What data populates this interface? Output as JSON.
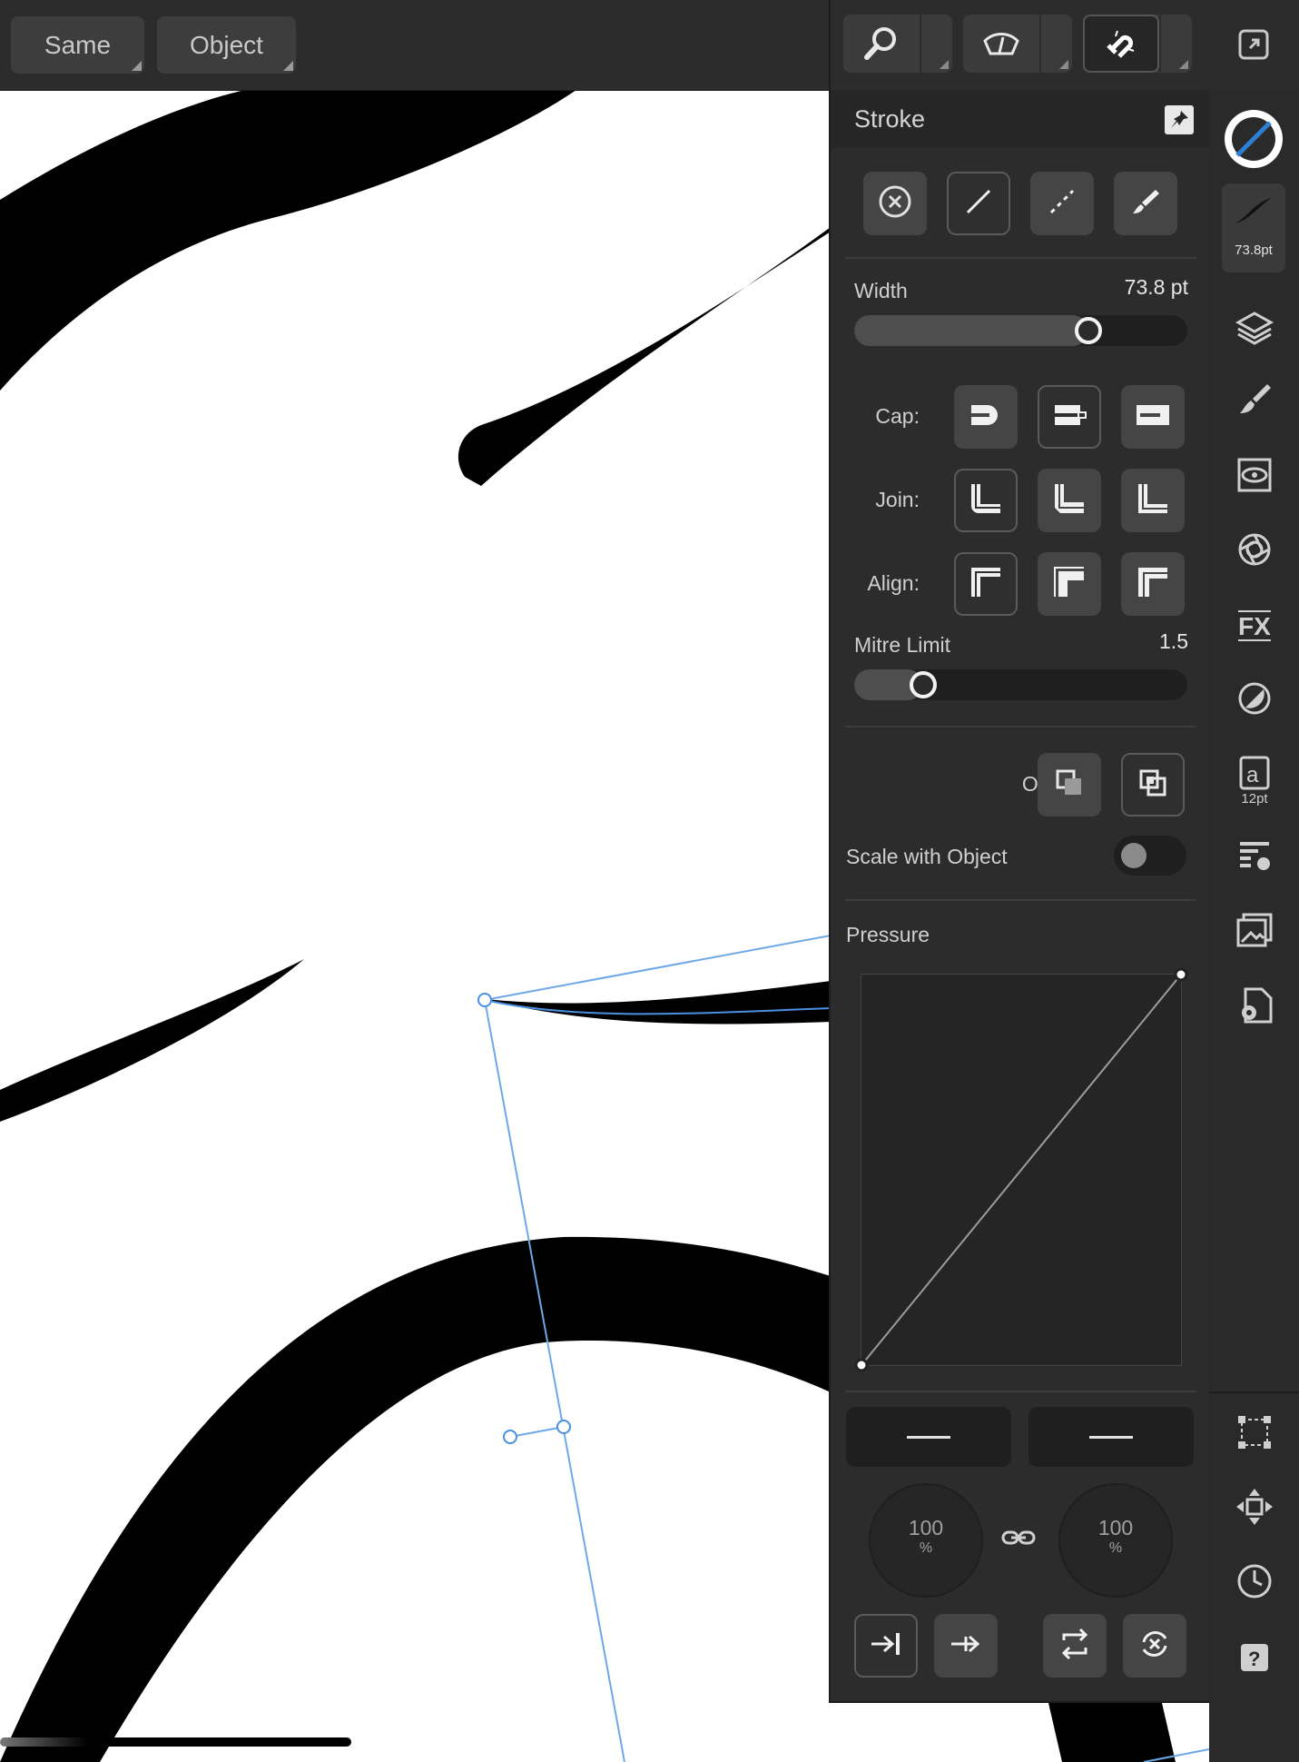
{
  "toolbar": {
    "same_label": "Same",
    "object_label": "Object"
  },
  "panel": {
    "title": "Stroke",
    "width_label": "Width",
    "width_value": "73.8 pt",
    "width_fraction": 0.72,
    "cap_label": "Cap:",
    "join_label": "Join:",
    "align_label": "Align:",
    "mitre_label": "Mitre Limit",
    "mitre_value": "1.5",
    "mitre_fraction": 0.18,
    "order_label": "Order:",
    "scale_label": "Scale with Object",
    "scale_on": false,
    "pressure_label": "Pressure",
    "dial_left_value": "100",
    "dial_left_unit": "%",
    "dial_right_value": "100",
    "dial_right_unit": "%"
  },
  "rail": {
    "stroke_size": "73.8pt",
    "text_size": "12pt"
  },
  "colors": {
    "accent": "#2d7fd3",
    "selection": "#4a90e2"
  }
}
